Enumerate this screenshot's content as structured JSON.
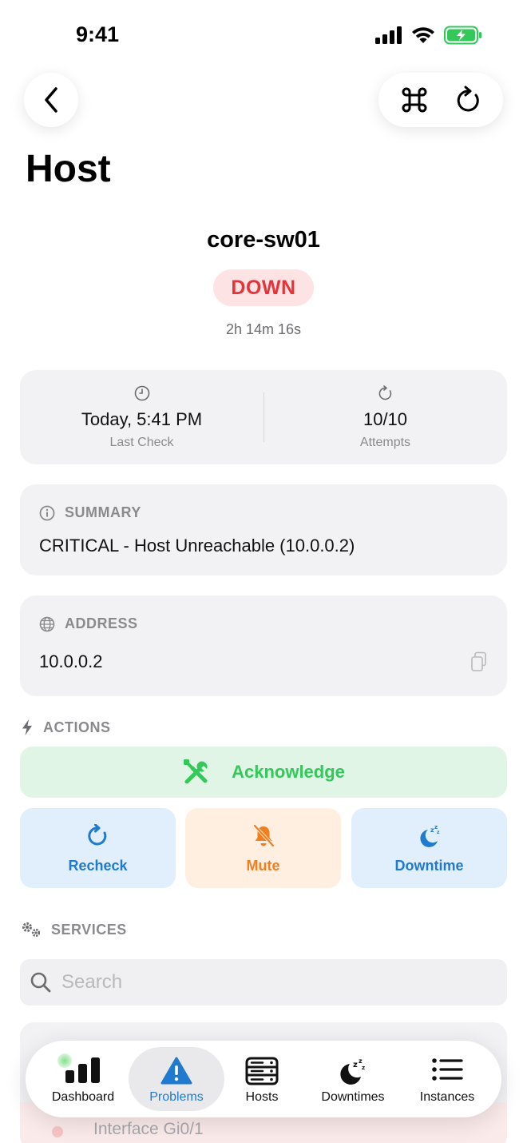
{
  "status_bar": {
    "time": "9:41"
  },
  "nav": {
    "back_icon": "chevron-left-icon",
    "command_icon": "command-icon",
    "refresh_icon": "refresh-icon"
  },
  "page": {
    "title": "Host"
  },
  "host": {
    "name": "core-sw01",
    "state": "DOWN",
    "duration": "2h 14m 16s"
  },
  "stats": {
    "last_check_value": "Today, 5:41 PM",
    "last_check_label": "Last Check",
    "attempts_value": "10/10",
    "attempts_label": "Attempts"
  },
  "summary": {
    "label": "SUMMARY",
    "text": "CRITICAL - Host Unreachable (10.0.0.2)"
  },
  "address": {
    "label": "ADDRESS",
    "value": "10.0.0.2"
  },
  "actions": {
    "label": "ACTIONS",
    "acknowledge": "Acknowledge",
    "recheck": "Recheck",
    "mute": "Mute",
    "downtime": "Downtime"
  },
  "services": {
    "label": "SERVICES",
    "search_placeholder": "Search",
    "peek_row": "Interface Gi0/1"
  },
  "tabs": [
    {
      "label": "Dashboard"
    },
    {
      "label": "Problems"
    },
    {
      "label": "Hosts"
    },
    {
      "label": "Downtimes"
    },
    {
      "label": "Instances"
    }
  ],
  "colors": {
    "down_red": "#e5333a",
    "ack_green": "#34c759",
    "action_blue": "#1f7ad0",
    "mute_orange": "#f07f1f",
    "card_gray": "#f2f2f4"
  }
}
